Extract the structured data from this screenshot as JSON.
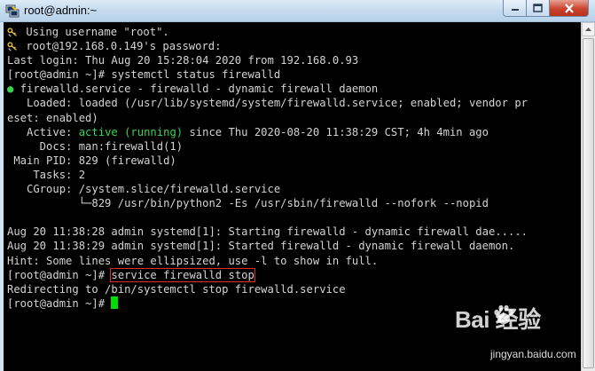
{
  "window": {
    "title": "root@admin:~",
    "title_icon": "putty-icon",
    "controls": [
      "minimize-icon",
      "maximize-icon",
      "close-icon"
    ]
  },
  "terminal": {
    "lines": [
      {
        "prefix_icon": "putty-key-icon",
        "segments": [
          {
            "text": "Using username \"root\"."
          }
        ]
      },
      {
        "prefix_icon": "putty-key-icon",
        "segments": [
          {
            "text": "root@192.168.0.149's password:"
          }
        ]
      },
      {
        "segments": [
          {
            "text": "Last login: Thu Aug 20 15:28:04 2020 from 192.168.0.93"
          }
        ]
      },
      {
        "segments": [
          {
            "text": "[root@admin ~]# systemctl status firewalld"
          }
        ]
      },
      {
        "segments": [
          {
            "text": "●",
            "color": "green"
          },
          {
            "text": " firewalld.service - firewalld - dynamic firewall daemon"
          }
        ]
      },
      {
        "segments": [
          {
            "text": "   Loaded: loaded (/usr/lib/systemd/system/firewalld.service; enabled; vendor pr"
          }
        ]
      },
      {
        "segments": [
          {
            "text": "eset: enabled)"
          }
        ]
      },
      {
        "segments": [
          {
            "text": "   Active: "
          },
          {
            "text": "active (running)",
            "color": "green"
          },
          {
            "text": " since Thu 2020-08-20 11:38:29 CST; 4h 4min ago"
          }
        ]
      },
      {
        "segments": [
          {
            "text": "     Docs: man:firewalld(1)"
          }
        ]
      },
      {
        "segments": [
          {
            "text": " Main PID: 829 (firewalld)"
          }
        ]
      },
      {
        "segments": [
          {
            "text": "    Tasks: 2"
          }
        ]
      },
      {
        "segments": [
          {
            "text": "   CGroup: /system.slice/firewalld.service"
          }
        ]
      },
      {
        "segments": [
          {
            "text": "           └─829 /usr/bin/python2 -Es /usr/sbin/firewalld --nofork --nopid"
          }
        ]
      },
      {
        "segments": [
          {
            "text": ""
          }
        ]
      },
      {
        "segments": [
          {
            "text": "Aug 20 11:38:28 admin systemd[1]: Starting firewalld - dynamic firewall dae....."
          }
        ]
      },
      {
        "segments": [
          {
            "text": "Aug 20 11:38:29 admin systemd[1]: Started firewalld - dynamic firewall daemon."
          }
        ]
      },
      {
        "segments": [
          {
            "text": "Hint: Some lines were ellipsized, use -l to show in full."
          }
        ]
      },
      {
        "segments": [
          {
            "text": "[root@admin ~]# "
          },
          {
            "text": "service firewalld stop",
            "boxed": true
          }
        ]
      },
      {
        "segments": [
          {
            "text": "Redirecting to /bin/systemctl stop firewalld.service"
          }
        ]
      },
      {
        "segments": [
          {
            "text": "[root@admin ~]# "
          }
        ],
        "cursor": true
      }
    ]
  },
  "colors": {
    "terminal_bg": "#000000",
    "terminal_fg": "#d3d3d3",
    "green": "#39d353",
    "cursor": "#00dd00",
    "highlight_box": "#e02b2b"
  },
  "watermark": {
    "logo": "Bai 经验",
    "url": "jingyan.baidu.com"
  }
}
